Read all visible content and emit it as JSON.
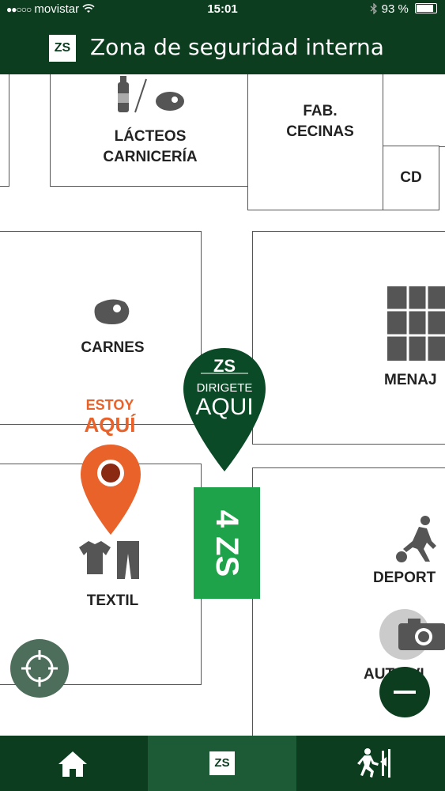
{
  "status_bar": {
    "carrier": "movistar",
    "time": "15:01",
    "battery": "93 %"
  },
  "header": {
    "logo": "ZS",
    "title": "Zona de seguridad interna"
  },
  "map": {
    "sections": [
      "LÁCTEOS\nCARNICERÍA",
      "FAB.\nCECINAS",
      "CD",
      "CARNES",
      "MENAJ",
      "TEXTIL",
      "DEPORT",
      "AUTO VI"
    ],
    "destination_pin": {
      "logo": "ZS",
      "line1": "DIRIGETE",
      "line2": "AQUI"
    },
    "you_are_here": {
      "line1": "ESTOY",
      "line2": "AQUÍ"
    },
    "zone_badge": "4 ZS"
  },
  "tab_bar": {
    "tabs": [
      {
        "icon": "home-icon"
      },
      {
        "icon": "zs-icon",
        "label": "ZS",
        "active": true
      },
      {
        "icon": "exit-icon"
      }
    ]
  },
  "colors": {
    "header_bg": "#0b3d1e",
    "active_tab": "#1d5a36",
    "badge_green": "#1fa34a",
    "pin_orange": "#e8622a"
  }
}
